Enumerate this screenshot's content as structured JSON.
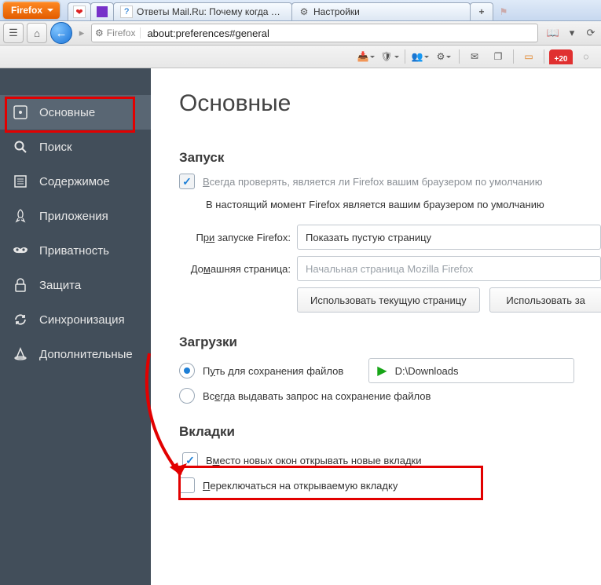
{
  "app_button": "Firefox",
  "tabs": [
    {
      "title": ""
    },
    {
      "title": ""
    },
    {
      "title": "Ответы Mail.Ru: Почему когда …"
    },
    {
      "title": "Настройки"
    }
  ],
  "addressbar": {
    "identity_label": "Firefox",
    "url": "about:preferences#general"
  },
  "toolbar_badge": "+20",
  "sidebar": {
    "items": [
      "Основные",
      "Поиск",
      "Содержимое",
      "Приложения",
      "Приватность",
      "Защита",
      "Синхронизация",
      "Дополнительные"
    ]
  },
  "page": {
    "title": "Основные",
    "startup": {
      "heading": "Запуск",
      "always_check": "Всегда проверять, является ли Firefox вашим браузером по умолчанию",
      "status": "В настоящий момент Firefox является вашим браузером по умолчанию",
      "on_start_label_pre": "При запуске Firefox:",
      "on_start_value": "Показать пустую страницу",
      "home_label_pre": "Домашняя страница:",
      "home_placeholder": "Начальная страница Mozilla Firefox",
      "btn_use_current": "Использовать текущую страницу",
      "btn_use_bookmark": "Использовать за"
    },
    "downloads": {
      "heading": "Загрузки",
      "path_label": "Путь для сохранения файлов",
      "path_value": "D:\\Downloads",
      "ask_label": "Всегда выдавать запрос на сохранение файлов"
    },
    "tabs": {
      "heading": "Вкладки",
      "open_in_tabs": "Вместо новых окон открывать новые вкладки",
      "switch_to": "Переключаться на открываемую вкладку"
    }
  }
}
